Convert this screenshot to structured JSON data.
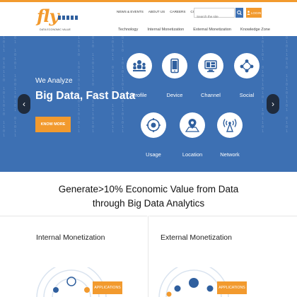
{
  "brand": {
    "logo_text": "fly",
    "tagline": "DATA ECONOMIC VALUE"
  },
  "header": {
    "top_links": [
      "NEWS & EVENTS",
      "ABOUT US",
      "CAREERS",
      "CONTACT US"
    ],
    "search_placeholder": "Search the site",
    "login_label": "LOGIN",
    "nav": [
      "Technology",
      "Internal Monetization",
      "External Monetization",
      "Knowledge Zone"
    ]
  },
  "hero": {
    "subtitle": "We Analyze",
    "title": "Big Data, Fast Data",
    "cta_label": "KNOW MORE",
    "prev_arrow": "‹",
    "next_arrow": "›",
    "features": [
      {
        "label": "Profile",
        "icon": "profile-icon"
      },
      {
        "label": "Device",
        "icon": "device-icon"
      },
      {
        "label": "Channel",
        "icon": "channel-icon"
      },
      {
        "label": "Social",
        "icon": "social-icon"
      },
      {
        "label": "Usage",
        "icon": "usage-icon"
      },
      {
        "label": "Location",
        "icon": "location-icon"
      },
      {
        "label": "Network",
        "icon": "network-icon"
      }
    ]
  },
  "headline": {
    "line1": "Generate>10% Economic Value from Data",
    "line2": "through Big Data Analytics"
  },
  "columns": {
    "internal": {
      "title": "Internal Monetization",
      "button": "APPLICATIONS"
    },
    "external": {
      "title": "External Monetization",
      "button": "APPLICATIONS"
    }
  },
  "colors": {
    "accent": "#f29a2e",
    "hero_bg": "#3d70b3",
    "icon_blue": "#2f5f9e"
  }
}
